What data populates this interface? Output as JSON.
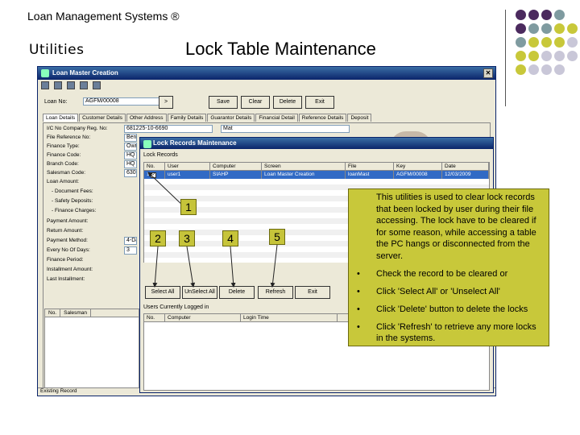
{
  "slide": {
    "header": "Loan Management Systems ®",
    "subtitle": "Utilities",
    "title": "Lock Table Maintenance"
  },
  "colors": {
    "accent_olive": "#c8c83a",
    "accent_purple": "#4b2a5e",
    "accent_teal": "#7f9ba0",
    "accent_lavender": "#c9c7d8"
  },
  "main_window": {
    "title": "Loan Master Creation",
    "loan_no_label": "Loan No:",
    "loan_no_value": "AGFM/00008",
    "buttons": {
      "save": "Save",
      "clear": "Clear",
      "delete": "Delete",
      "exit": "Exit"
    },
    "tabs": [
      "Loan Details",
      "Customer Details",
      "Other Address",
      "Family Details",
      "Guarantor Details",
      "Financial Detail",
      "Reference Details",
      "Deposit"
    ],
    "fields": [
      {
        "label": "I/C No Company Reg. No:",
        "value": "681225-10-6690"
      },
      {
        "label": "File Reference No:",
        "value": "Ben"
      },
      {
        "label": "Finance Type:",
        "value": "Own"
      },
      {
        "label": "Finance Code:",
        "value": "HQ"
      },
      {
        "label": "Branch Code:",
        "value": "HQ"
      },
      {
        "label": "Salesman Code:",
        "value": "630"
      },
      {
        "label": "Loan Amount:",
        "value": ""
      },
      {
        "label": "- Document Fees:",
        "value": ""
      },
      {
        "label": "- Safety Deposits:",
        "value": ""
      },
      {
        "label": "- Finance Charges:",
        "value": ""
      },
      {
        "label": "Payment Amount:",
        "value": ""
      },
      {
        "label": "Return Amount:",
        "value": ""
      },
      {
        "label": "Payment Method:",
        "value": "4-Da"
      },
      {
        "label": "Every No Of Days:",
        "value": "3"
      },
      {
        "label": "Finance Period:",
        "value": ""
      },
      {
        "label": "Installment Amount:",
        "value": ""
      },
      {
        "label": "Last Installment:",
        "value": ""
      }
    ],
    "name_value": "Mat",
    "bottom_grid_headers": [
      "No.",
      "Salesman"
    ],
    "status_text": "Existing Record"
  },
  "lock_dialog": {
    "title": "Lock Records Maintenance",
    "section_label": "Lock Records",
    "columns": [
      "No.",
      "User",
      "Computer",
      "Screen",
      "File",
      "Key",
      "Date"
    ],
    "rows": [
      {
        "no": "1",
        "checked": "✓",
        "user": "user1",
        "computer": "SIAHP",
        "screen": "Loan Master Creation",
        "file": "loanMast",
        "key": "AGFM/00008",
        "date": "12/03/2009"
      }
    ],
    "buttons": {
      "select_all": "Select All",
      "unselect_all": "UnSelect All",
      "delete": "Delete",
      "refresh": "Refresh",
      "exit": "Exit"
    },
    "users_label": "Users Currently Logged in",
    "users_columns": [
      "No.",
      "Computer",
      "Login Time"
    ]
  },
  "callouts": [
    "1",
    "2",
    "3",
    "4",
    "5"
  ],
  "info_box": {
    "intro": "This utilities is used to clear lock records that been locked by user during their file accessing. The lock have to be cleared if for some reason, while accessing a table the PC hangs or disconnected from the server.",
    "steps": [
      "Check the record to be cleared or",
      "Click 'Select All' or 'Unselect All'",
      "Click 'Delete' button to delete the locks",
      "Click 'Refresh' to retrieve any more locks in the systems."
    ]
  }
}
